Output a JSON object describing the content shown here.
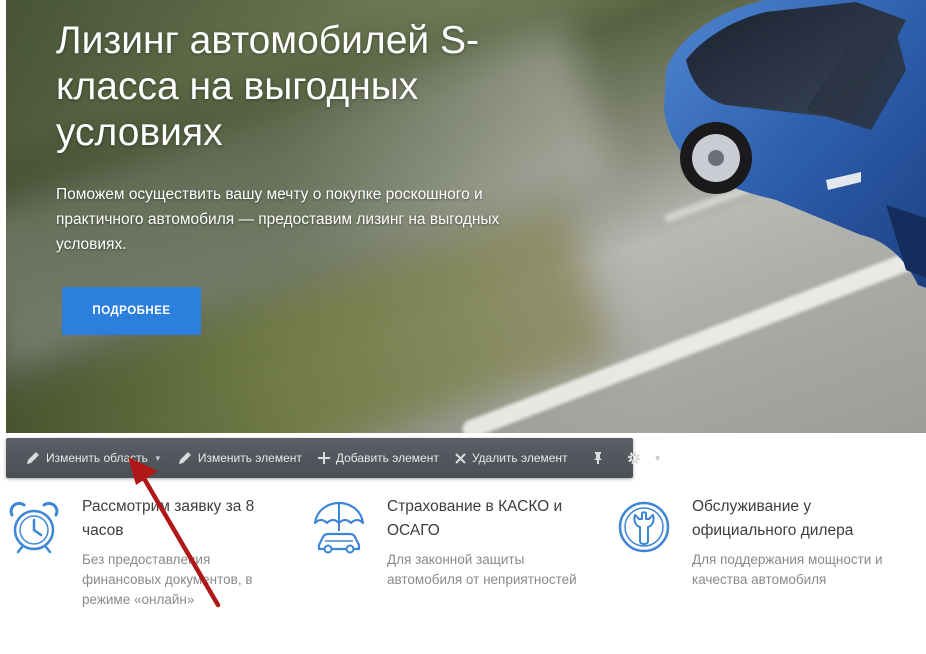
{
  "hero": {
    "title": "Лизинг автомобилей S-класса на выгодных условиях",
    "description": "Поможем осуществить вашу мечту о покупке роскошного и практичного автомобиля — предоставим лизинг на выгодных условиях.",
    "button_label": "ПОДРОБНЕЕ"
  },
  "toolbar": {
    "edit_area": "Изменить область",
    "edit_element": "Изменить элемент",
    "add_element": "Добавить элемент",
    "delete_element": "Удалить элемент"
  },
  "features": [
    {
      "title": "Рассмотрим заявку за 8 часов",
      "text": "Без предоставления финансовых документов, в режиме «онлайн»",
      "icon": "alarm-clock-icon"
    },
    {
      "title": "Страхование в КАСКО и ОСАГО",
      "text": "Для законной защиты автомобиля от неприятностей",
      "icon": "umbrella-car-icon"
    },
    {
      "title": "Обслуживание у официального дилера",
      "text": "Для поддержания мощности и качества автомобиля",
      "icon": "wrench-service-icon"
    }
  ],
  "colors": {
    "accent": "#2d7fdd",
    "icon_blue": "#3d86d6",
    "toolbar": "#52575e",
    "arrow": "#b01818"
  }
}
